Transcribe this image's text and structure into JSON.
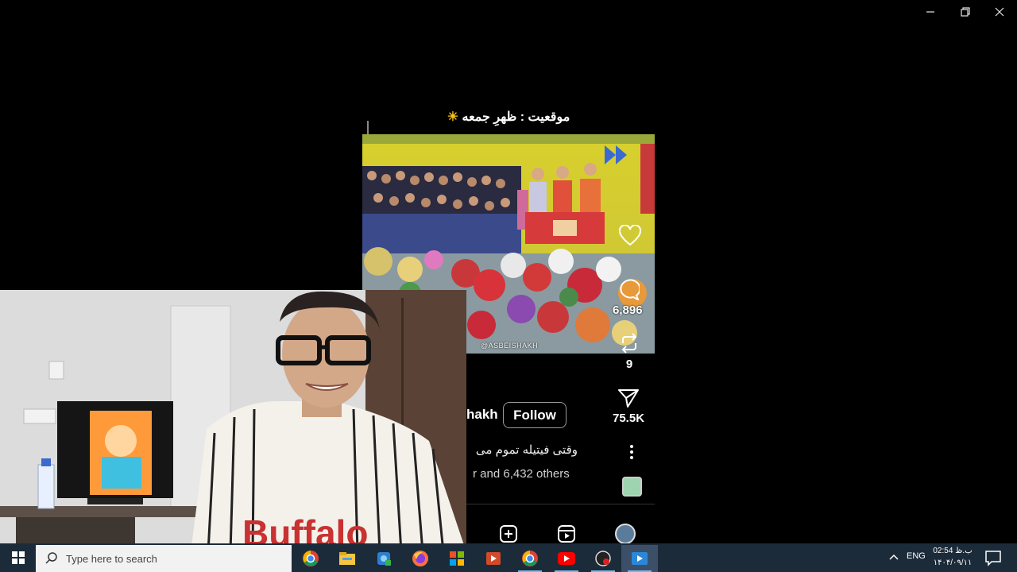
{
  "window": {
    "minimize": "minimize-icon",
    "maximize": "restore-icon",
    "close": "close-icon"
  },
  "reel": {
    "caption": "موقعیت : ظهرِ جمعه",
    "caption_emoji": "☀️",
    "watermark": "@ASBEISHAKH",
    "likes": "",
    "comments": "6,896",
    "reposts": "9",
    "shares": "75.5K",
    "username": "hakh",
    "follow_label": "Follow",
    "post_text": "وقتی فیتیله تموم می",
    "likes_text": "r and 6,432 others"
  },
  "taskbar": {
    "search_placeholder": "Type here to search",
    "apps": [
      "chrome-icon",
      "file-explorer-icon",
      "network-app-icon",
      "firefox-icon",
      "store-icon",
      "media-player-icon",
      "chrome-icon",
      "youtube-icon",
      "recorder-icon",
      "video-app-icon"
    ],
    "language": "ENG",
    "time": "02:54 ب.ظ",
    "date": "۱۴۰۴/۰۹/۱۱"
  },
  "colors": {
    "taskbar_bg": "#1c2b3a",
    "accent": "#76b9ed"
  }
}
